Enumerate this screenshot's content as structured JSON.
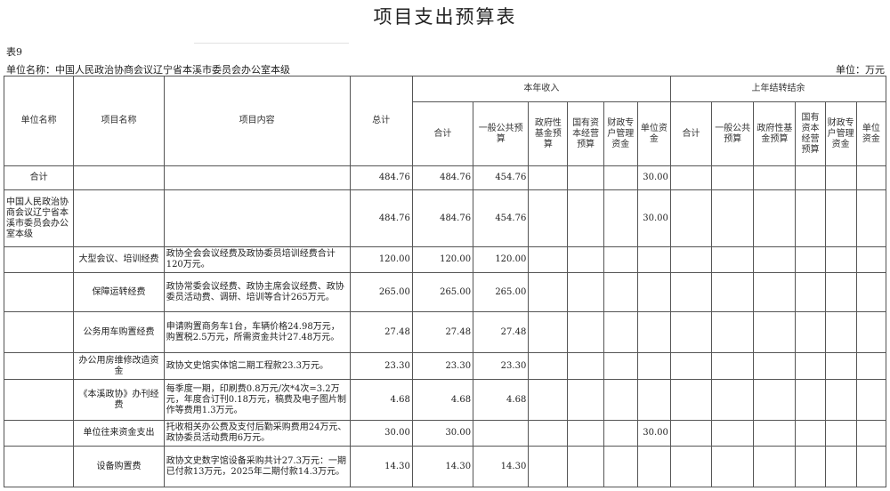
{
  "title": "项目支出预算表",
  "table_no": "表9",
  "unit_name_label": "单位名称：中国人民政治协商会议辽宁省本溪市委员会办公室本级",
  "unit_label": "单位：万元",
  "headers": {
    "unit_name": "单位名称",
    "project_name": "项目名称",
    "project_content": "项目内容",
    "total": "总计",
    "current_year": "本年收入",
    "carryover": "上年结转结余",
    "cy_total": "合计",
    "cy_general": "一般公共预算",
    "cy_gov_fund": "政府性基金预算",
    "cy_soe": "国有资本经营预算",
    "cy_fiscal": "财政专户管理资金",
    "cy_unit": "单位资金",
    "co_total": "合计",
    "co_general": "一般公共预算",
    "co_gov_fund": "政府性基金预算",
    "co_soe": "国有资本经营预算",
    "co_fiscal": "财政专户管理资金",
    "co_unit": "单位资金"
  },
  "rows": [
    {
      "unit": "合计",
      "project": "",
      "content": "",
      "total": "484.76",
      "cy_total": "484.76",
      "cy_general": "454.76",
      "cy_unit": "30.00"
    },
    {
      "unit": "中国人民政治协商会议辽宁省本溪市委员会办公室本级",
      "project": "",
      "content": "",
      "total": "484.76",
      "cy_total": "484.76",
      "cy_general": "454.76",
      "cy_unit": "30.00"
    },
    {
      "unit": "",
      "project": "大型会议、培训经费",
      "content": "政协全会会议经费及政协委员培训经费合计120万元。",
      "total": "120.00",
      "cy_total": "120.00",
      "cy_general": "120.00",
      "cy_unit": ""
    },
    {
      "unit": "",
      "project": "保障运转经费",
      "content": "政协常委会议经费、政协主席会议经费、政协委员活动费、调研、培训等合计265万元。",
      "total": "265.00",
      "cy_total": "265.00",
      "cy_general": "265.00",
      "cy_unit": ""
    },
    {
      "unit": "",
      "project": "公务用车购置经费",
      "content": "申请购置商务车1台，车辆价格24.98万元，购置税2.5万元，所需资金共计27.48万元。",
      "total": "27.48",
      "cy_total": "27.48",
      "cy_general": "27.48",
      "cy_unit": ""
    },
    {
      "unit": "",
      "project": "办公用房维修改造资金",
      "content": "政协文史馆实体馆二期工程款23.3万元。",
      "total": "23.30",
      "cy_total": "23.30",
      "cy_general": "23.30",
      "cy_unit": ""
    },
    {
      "unit": "",
      "project": "《本溪政协》办刊经费",
      "content": "每季度一期，印刷费0.8万元/次*4次=3.2万元，年度合订刊0.18万元，稿费及电子图片制作等费用1.3万元。",
      "total": "4.68",
      "cy_total": "4.68",
      "cy_general": "4.68",
      "cy_unit": ""
    },
    {
      "unit": "",
      "project": "单位往来资金支出",
      "content": "托收相关办公费及支付后勤采购费用24万元、政协委员活动费用6万元。",
      "total": "30.00",
      "cy_total": "30.00",
      "cy_general": "",
      "cy_unit": "30.00"
    },
    {
      "unit": "",
      "project": "设备购置费",
      "content": "政协文史数字馆设备采购共计27.3万元：一期已付款13万元，2025年二期付款14.3万元。",
      "total": "14.30",
      "cy_total": "14.30",
      "cy_general": "14.30",
      "cy_unit": ""
    }
  ]
}
